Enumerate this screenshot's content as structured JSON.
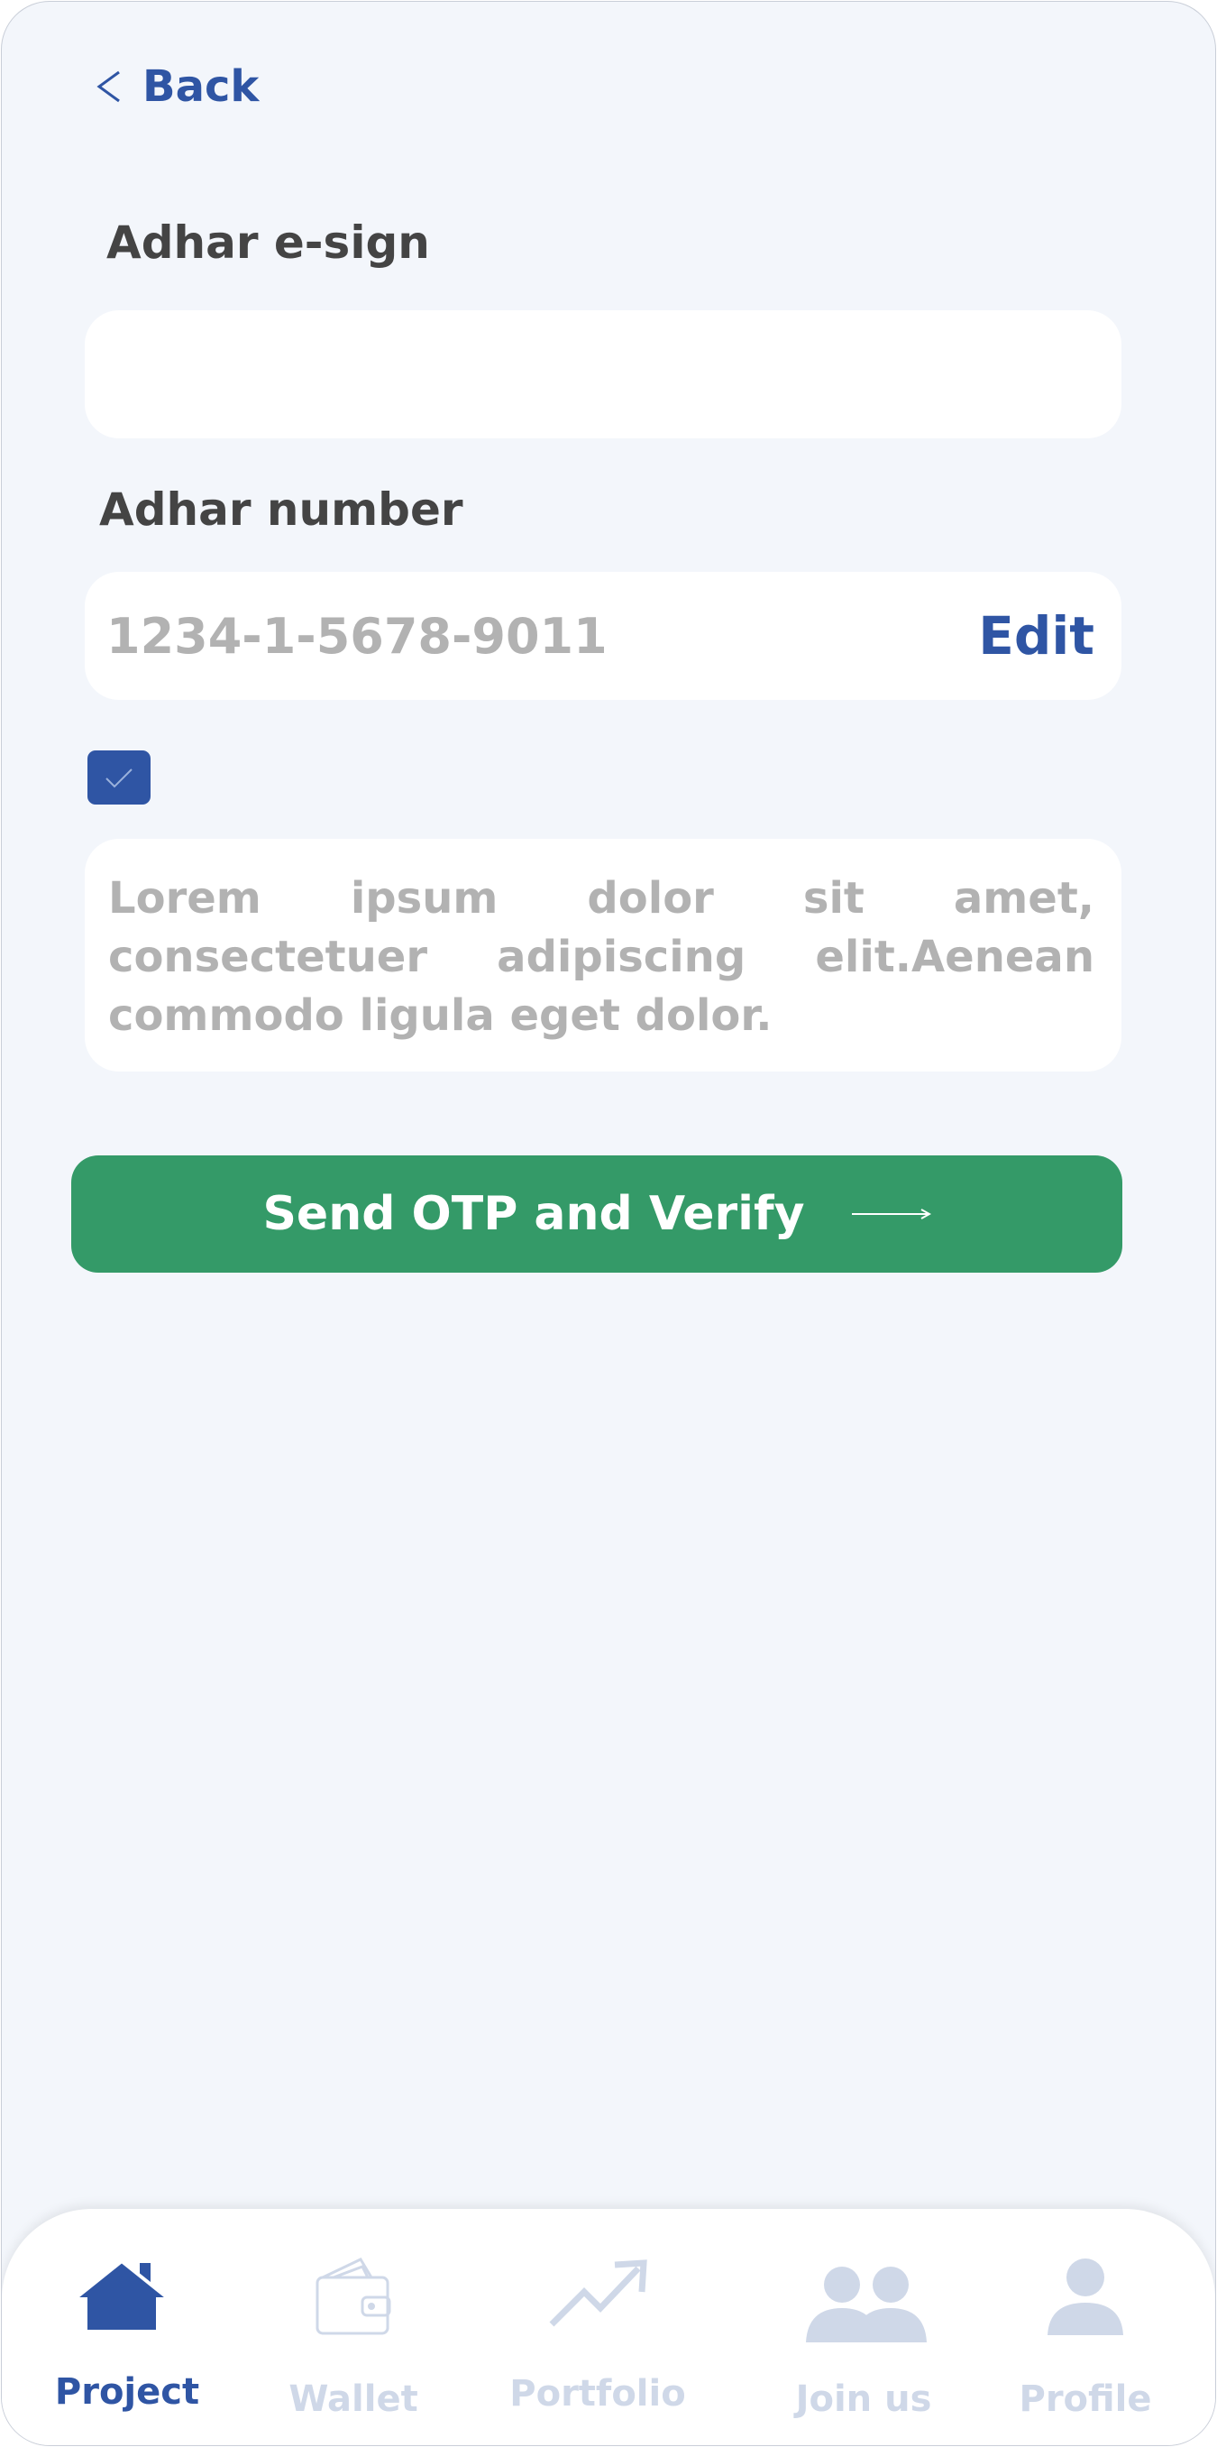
{
  "header": {
    "back_label": "Back"
  },
  "esign": {
    "label": "Adhar e-sign",
    "value": ""
  },
  "adhar": {
    "label": "Adhar number",
    "value": "1234-1-5678-9011",
    "edit_label": "Edit"
  },
  "consent": {
    "checked": true,
    "text": "Lorem ipsum dolor sit amet, consectetuer adipiscing elit.Aenean commodo ligula eget dolor."
  },
  "action": {
    "send_label": "Send OTP and Verify"
  },
  "colors": {
    "accent": "#2f55a4",
    "button": "#349a68",
    "background": "#f3f6fb",
    "muted_icon": "#cfd8e8"
  },
  "nav": {
    "items": [
      {
        "label": "Project",
        "icon": "home-icon",
        "active": true
      },
      {
        "label": "Wallet",
        "icon": "wallet-icon",
        "active": false
      },
      {
        "label": "Portfolio",
        "icon": "trending-up-icon",
        "active": false
      },
      {
        "label": "Join us",
        "icon": "group-icon",
        "active": false
      },
      {
        "label": "Profile",
        "icon": "user-icon",
        "active": false
      }
    ]
  }
}
